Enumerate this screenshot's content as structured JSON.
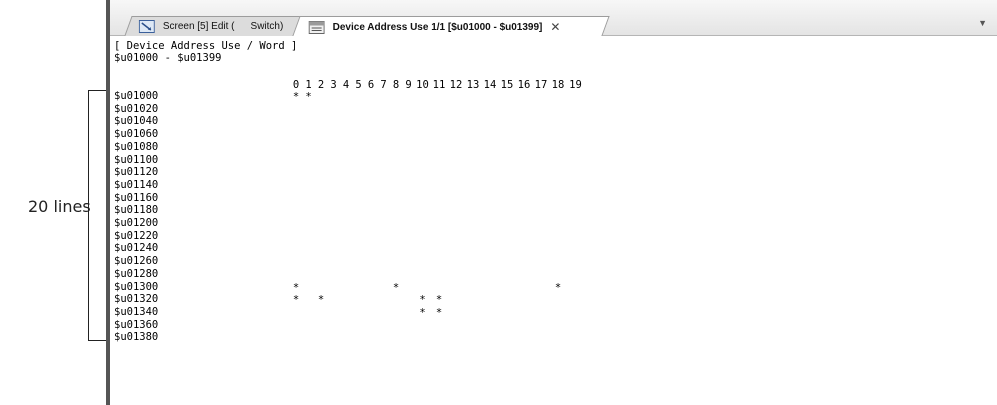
{
  "annotation": {
    "label": "20 lines"
  },
  "tabs": {
    "inactive": {
      "label_left": "Screen [5] Edit (",
      "label_right": "Switch)"
    },
    "active": {
      "label": "Device Address Use  1/1  [$u01000 - $u01399]",
      "close": "✕"
    },
    "dropdown": "▼"
  },
  "report": {
    "header_line1": "[ Device Address Use / Word ]",
    "header_line2": "$u01000 - $u01399",
    "columns": [
      "0",
      "1",
      "2",
      "3",
      "4",
      "5",
      "6",
      "7",
      "8",
      "9",
      "10",
      "11",
      "12",
      "13",
      "14",
      "15",
      "16",
      "17",
      "18",
      "19"
    ],
    "rows": [
      {
        "label": "$u01000",
        "used": [
          0,
          1
        ]
      },
      {
        "label": "$u01020",
        "used": []
      },
      {
        "label": "$u01040",
        "used": []
      },
      {
        "label": "$u01060",
        "used": []
      },
      {
        "label": "$u01080",
        "used": []
      },
      {
        "label": "$u01100",
        "used": []
      },
      {
        "label": "$u01120",
        "used": []
      },
      {
        "label": "$u01140",
        "used": []
      },
      {
        "label": "$u01160",
        "used": []
      },
      {
        "label": "$u01180",
        "used": []
      },
      {
        "label": "$u01200",
        "used": []
      },
      {
        "label": "$u01220",
        "used": []
      },
      {
        "label": "$u01240",
        "used": []
      },
      {
        "label": "$u01260",
        "used": []
      },
      {
        "label": "$u01280",
        "used": []
      },
      {
        "label": "$u01300",
        "used": [
          0,
          8,
          18
        ]
      },
      {
        "label": "$u01320",
        "used": [
          0,
          2,
          10,
          11
        ]
      },
      {
        "label": "$u01340",
        "used": [
          10,
          11
        ]
      },
      {
        "label": "$u01360",
        "used": []
      },
      {
        "label": "$u01380",
        "used": []
      }
    ],
    "mark_char": "*"
  }
}
